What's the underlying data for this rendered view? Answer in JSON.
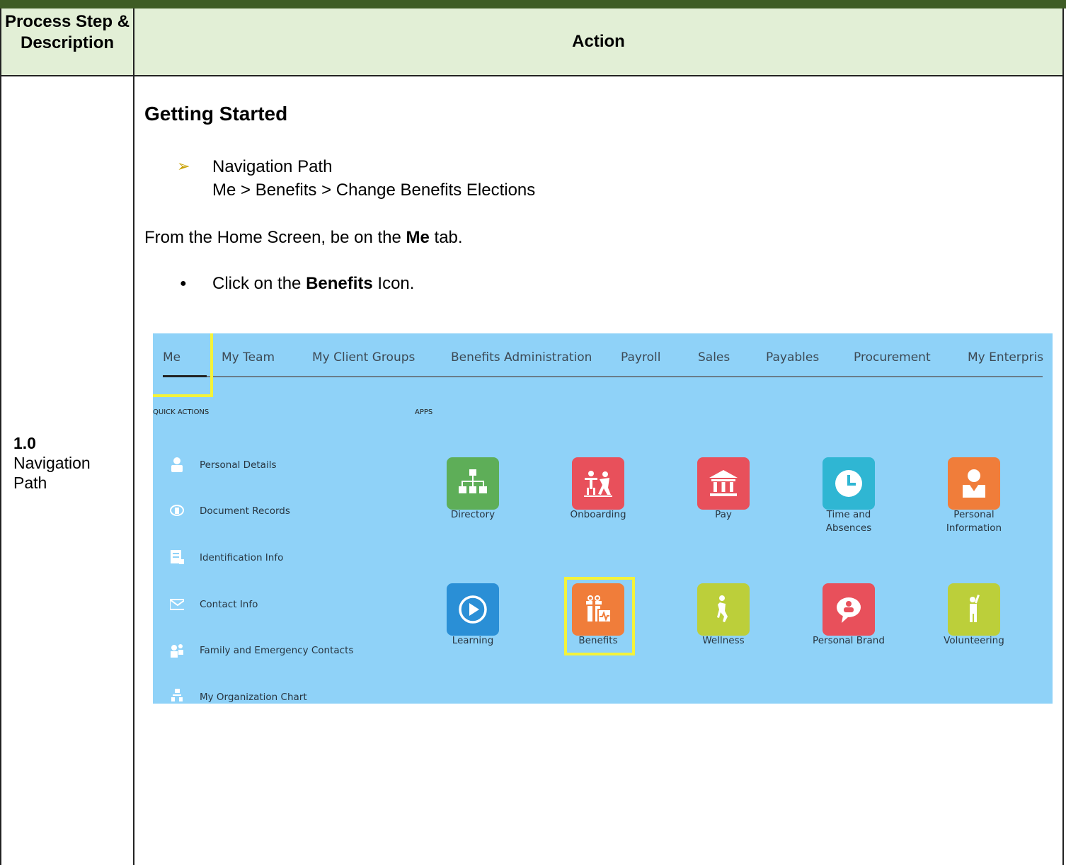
{
  "header": {
    "col1": "Process Step & Description",
    "col2": "Action"
  },
  "step": {
    "number": "1.0",
    "name": "Navigation Path"
  },
  "content": {
    "title": "Getting Started",
    "nav_label": "Navigation Path",
    "nav_path": "Me > Benefits > Change Benefits Elections",
    "home_pre": "From the Home Screen, be on the ",
    "home_bold": "Me",
    "home_post": " tab.",
    "click_pre": "Click on the ",
    "click_bold": "Benefits",
    "click_post": " Icon."
  },
  "screenshot": {
    "tabs": [
      "Me",
      "My Team",
      "My Client Groups",
      "Benefits Administration",
      "Payroll",
      "Sales",
      "Payables",
      "Procurement",
      "My Enterpris"
    ],
    "quick_actions_label": "QUICK ACTIONS",
    "apps_label": "APPS",
    "quick_actions": [
      "Personal Details",
      "Document Records",
      "Identification Info",
      "Contact Info",
      "Family and Emergency Contacts",
      "My Organization Chart"
    ],
    "apps": [
      {
        "label": "Directory",
        "icon": "org-chart-icon",
        "color": "#5eae58"
      },
      {
        "label": "Onboarding",
        "icon": "onboarding-icon",
        "color": "#e8505b"
      },
      {
        "label": "Pay",
        "icon": "bank-icon",
        "color": "#e8505b"
      },
      {
        "label": "Time and Absences",
        "icon": "clock-icon",
        "color": "#2fb6d3"
      },
      {
        "label": "Personal Information",
        "icon": "person-icon",
        "color": "#f07d3a"
      },
      {
        "label": "Learning",
        "icon": "play-icon",
        "color": "#2a8fd6"
      },
      {
        "label": "Benefits",
        "icon": "gift-icon",
        "color": "#f07d3a"
      },
      {
        "label": "Wellness",
        "icon": "wellness-icon",
        "color": "#bccf3a"
      },
      {
        "label": "Personal Brand",
        "icon": "chat-person-icon",
        "color": "#e8505b"
      },
      {
        "label": "Volunteering",
        "icon": "volunteer-icon",
        "color": "#bccf3a"
      }
    ],
    "highlight_color": "#f4f33a"
  }
}
